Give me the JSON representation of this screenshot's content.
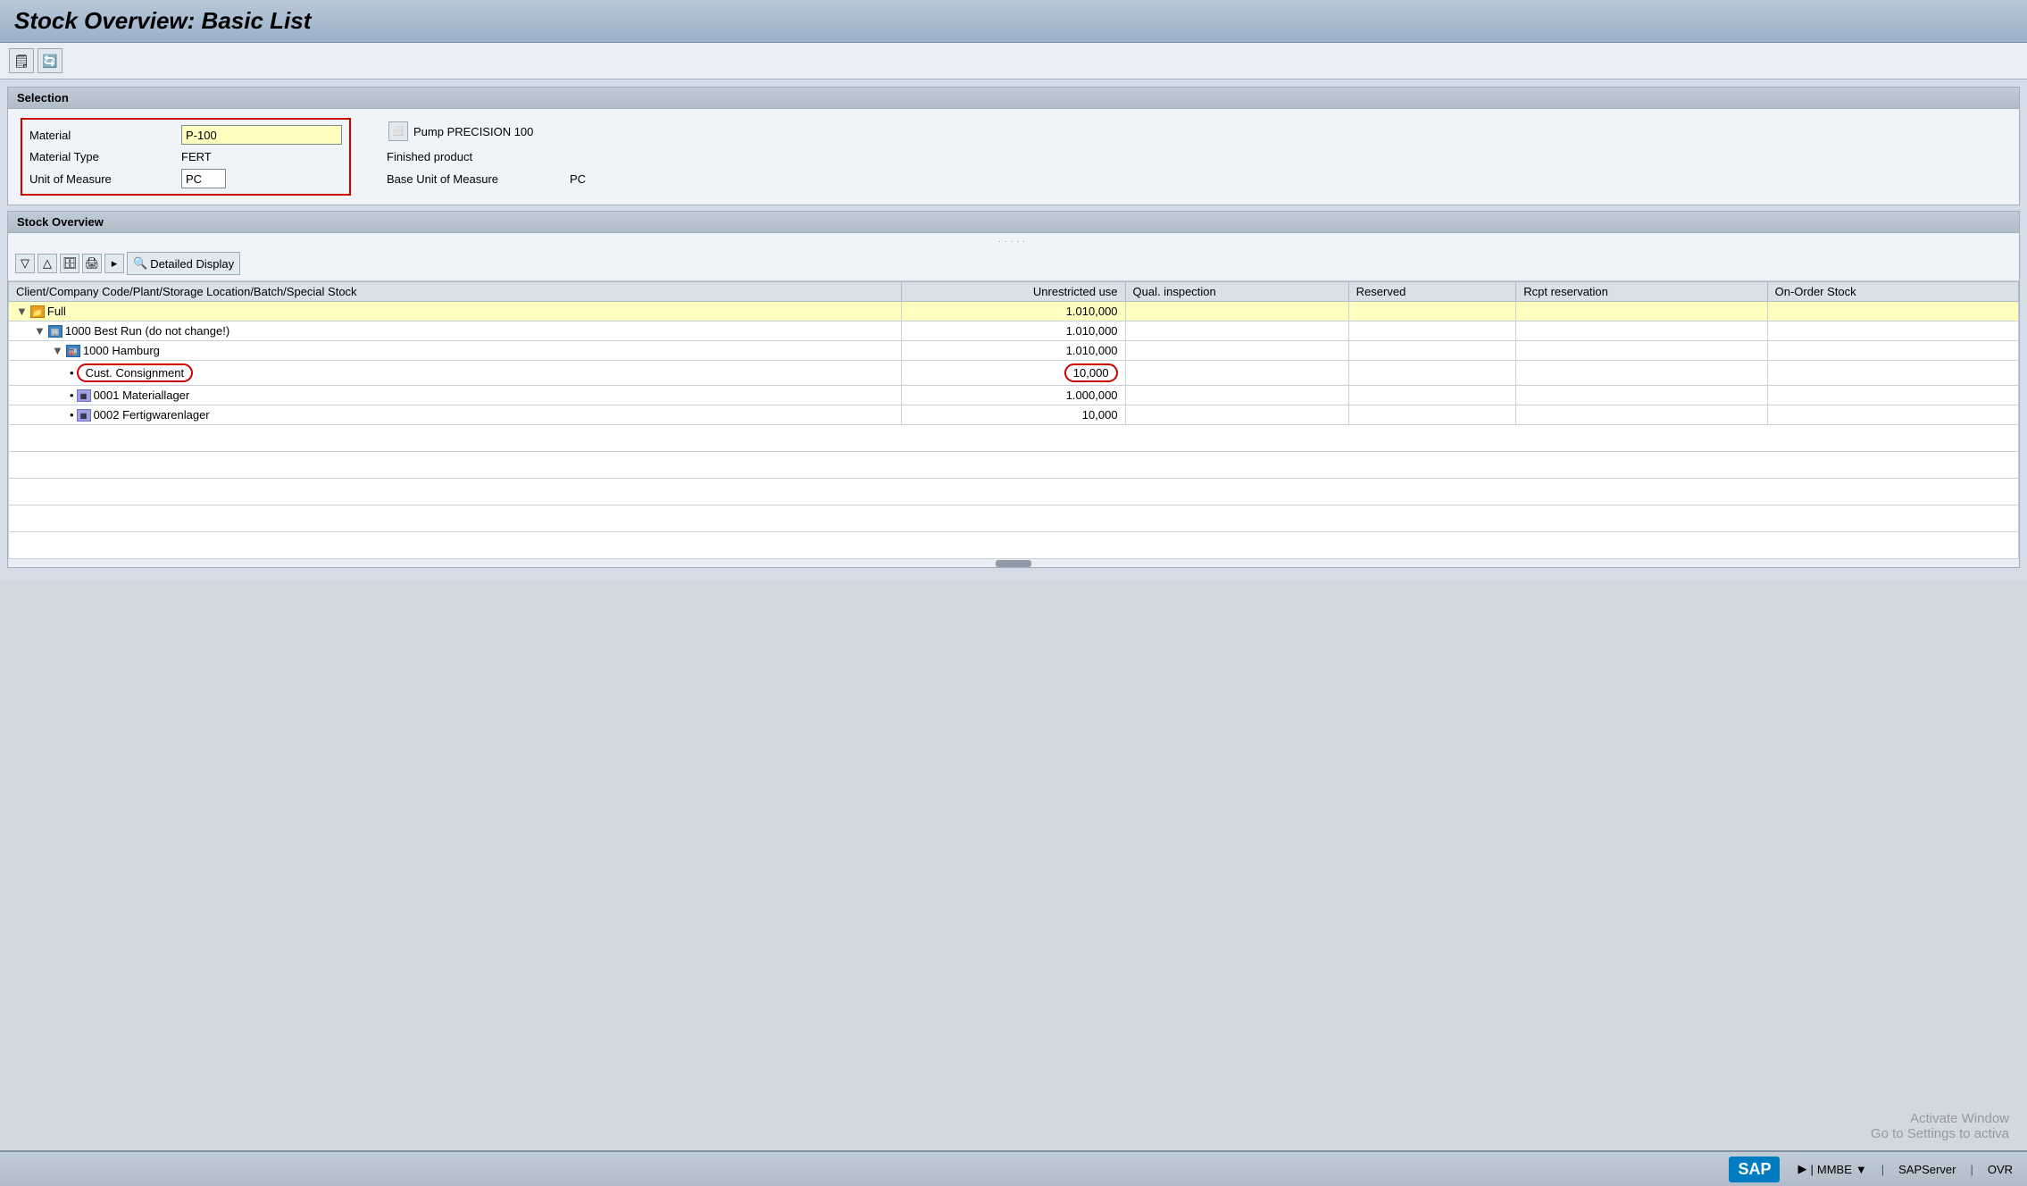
{
  "title": "Stock Overview: Basic List",
  "toolbar": {
    "btn1_label": "📋",
    "btn2_label": "🔄"
  },
  "selection": {
    "section_title": "Selection",
    "material_label": "Material",
    "material_value": "P-100",
    "material_desc": "Pump PRECISION 100",
    "material_type_label": "Material Type",
    "material_type_value": "FERT",
    "material_type_desc": "Finished product",
    "uom_label": "Unit of Measure",
    "uom_value": "PC",
    "base_uom_label": "Base Unit of Measure",
    "base_uom_value": "PC"
  },
  "stock_overview": {
    "section_title": "Stock Overview",
    "detailed_display_label": "Detailed Display",
    "dots": ".....",
    "columns": [
      "Client/Company Code/Plant/Storage Location/Batch/Special Stock",
      "Unrestricted use",
      "Qual. inspection",
      "Reserved",
      "Rcpt reservation",
      "On-Order Stock"
    ],
    "rows": [
      {
        "id": "full",
        "indent": 0,
        "icon": "folder",
        "name": "Full",
        "unrestricted": "1.010,000",
        "qual": "",
        "reserved": "",
        "rcpt": "",
        "onorder": "",
        "highlight": true
      },
      {
        "id": "1000-best-run",
        "indent": 1,
        "icon": "company",
        "name": "1000 Best Run (do not change!)",
        "unrestricted": "1.010,000",
        "qual": "",
        "reserved": "",
        "rcpt": "",
        "onorder": "",
        "highlight": false
      },
      {
        "id": "1000-hamburg",
        "indent": 2,
        "icon": "plant",
        "name": "1000 Hamburg",
        "unrestricted": "1.010,000",
        "qual": "",
        "reserved": "",
        "rcpt": "",
        "onorder": "",
        "highlight": false
      },
      {
        "id": "cust-consignment",
        "indent": 3,
        "icon": "dot",
        "name": "Cust. Consignment",
        "unrestricted": "10,000",
        "qual": "",
        "reserved": "",
        "rcpt": "",
        "onorder": "",
        "highlight": false,
        "red_oval": true
      },
      {
        "id": "0001-materiallager",
        "indent": 3,
        "icon": "storage",
        "name": "0001 Materiallager",
        "unrestricted": "1.000,000",
        "qual": "",
        "reserved": "",
        "rcpt": "",
        "onorder": "",
        "highlight": false
      },
      {
        "id": "0002-fertigwarenlager",
        "indent": 3,
        "icon": "storage",
        "name": "0002 Fertigwarenlager",
        "unrestricted": "10,000",
        "qual": "",
        "reserved": "",
        "rcpt": "",
        "onorder": "",
        "highlight": false
      }
    ]
  },
  "status_bar": {
    "sap_label": "SAP",
    "transaction": "MMBE",
    "server": "SAPServer",
    "mode": "OVR"
  },
  "activate_window": {
    "line1": "Activate Window",
    "line2": "Go to Settings to activa"
  }
}
